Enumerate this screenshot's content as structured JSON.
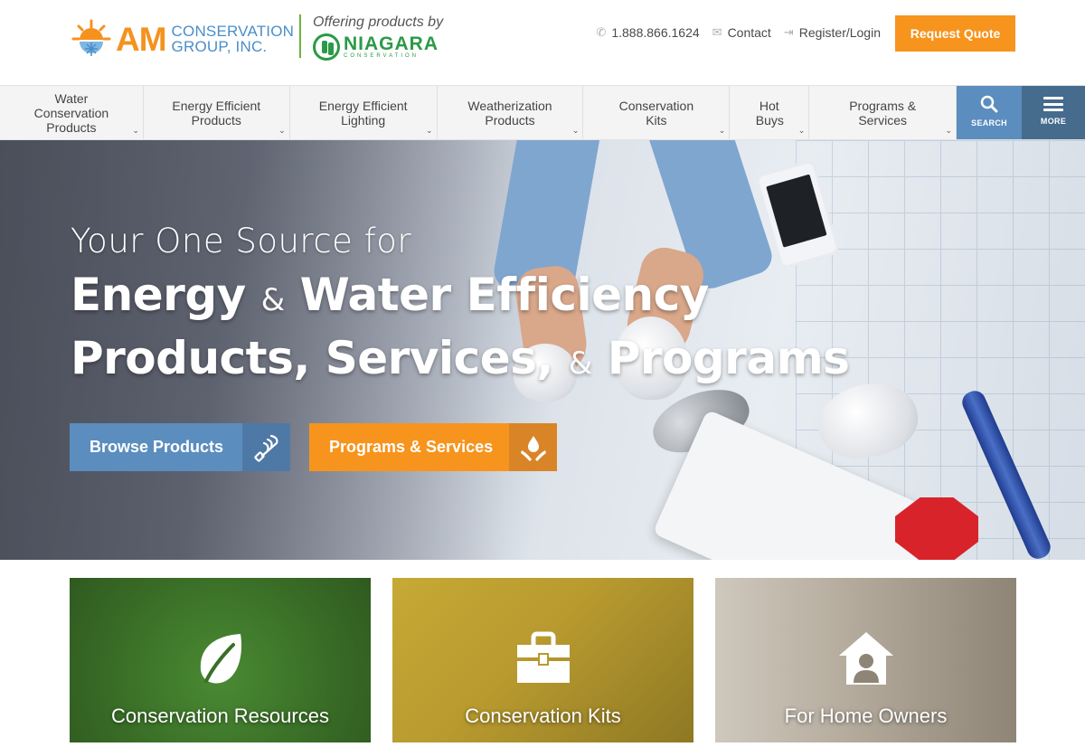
{
  "header": {
    "logo": {
      "am": "AM",
      "line1": "CONSERVATION",
      "line2": "GROUP, INC."
    },
    "partner": {
      "offering": "Offering products by",
      "name": "NIAGARA",
      "sub": "CONSERVATION"
    },
    "phone": "1.888.866.1624",
    "contact": "Contact",
    "register": "Register/Login",
    "quote": "Request Quote"
  },
  "nav": {
    "items": [
      {
        "label": "Water Conservation Products"
      },
      {
        "label": "Energy Efficient Products"
      },
      {
        "label": "Energy Efficient Lighting"
      },
      {
        "label": "Weatherization Products"
      },
      {
        "label": "Conservation Kits"
      },
      {
        "label": "Hot Buys"
      },
      {
        "label": "Programs & Services"
      }
    ],
    "search": "SEARCH",
    "more": "MORE"
  },
  "hero": {
    "line1": "Your One Source for",
    "line2a": "Energy",
    "amp": "&",
    "line2b": "Water Efficiency",
    "line3a": "Products, Services,",
    "line3b": "Programs",
    "browse": "Browse Products",
    "programs": "Programs & Services"
  },
  "cards": [
    {
      "label": "Conservation Resources",
      "icon": "leaf-icon"
    },
    {
      "label": "Conservation Kits",
      "icon": "toolbox-icon"
    },
    {
      "label": "For Home Owners",
      "icon": "house-person-icon"
    }
  ],
  "colors": {
    "orange": "#f7941d",
    "blue": "#5b8dbf",
    "navy": "#456b8d",
    "green": "#2b9a48"
  }
}
